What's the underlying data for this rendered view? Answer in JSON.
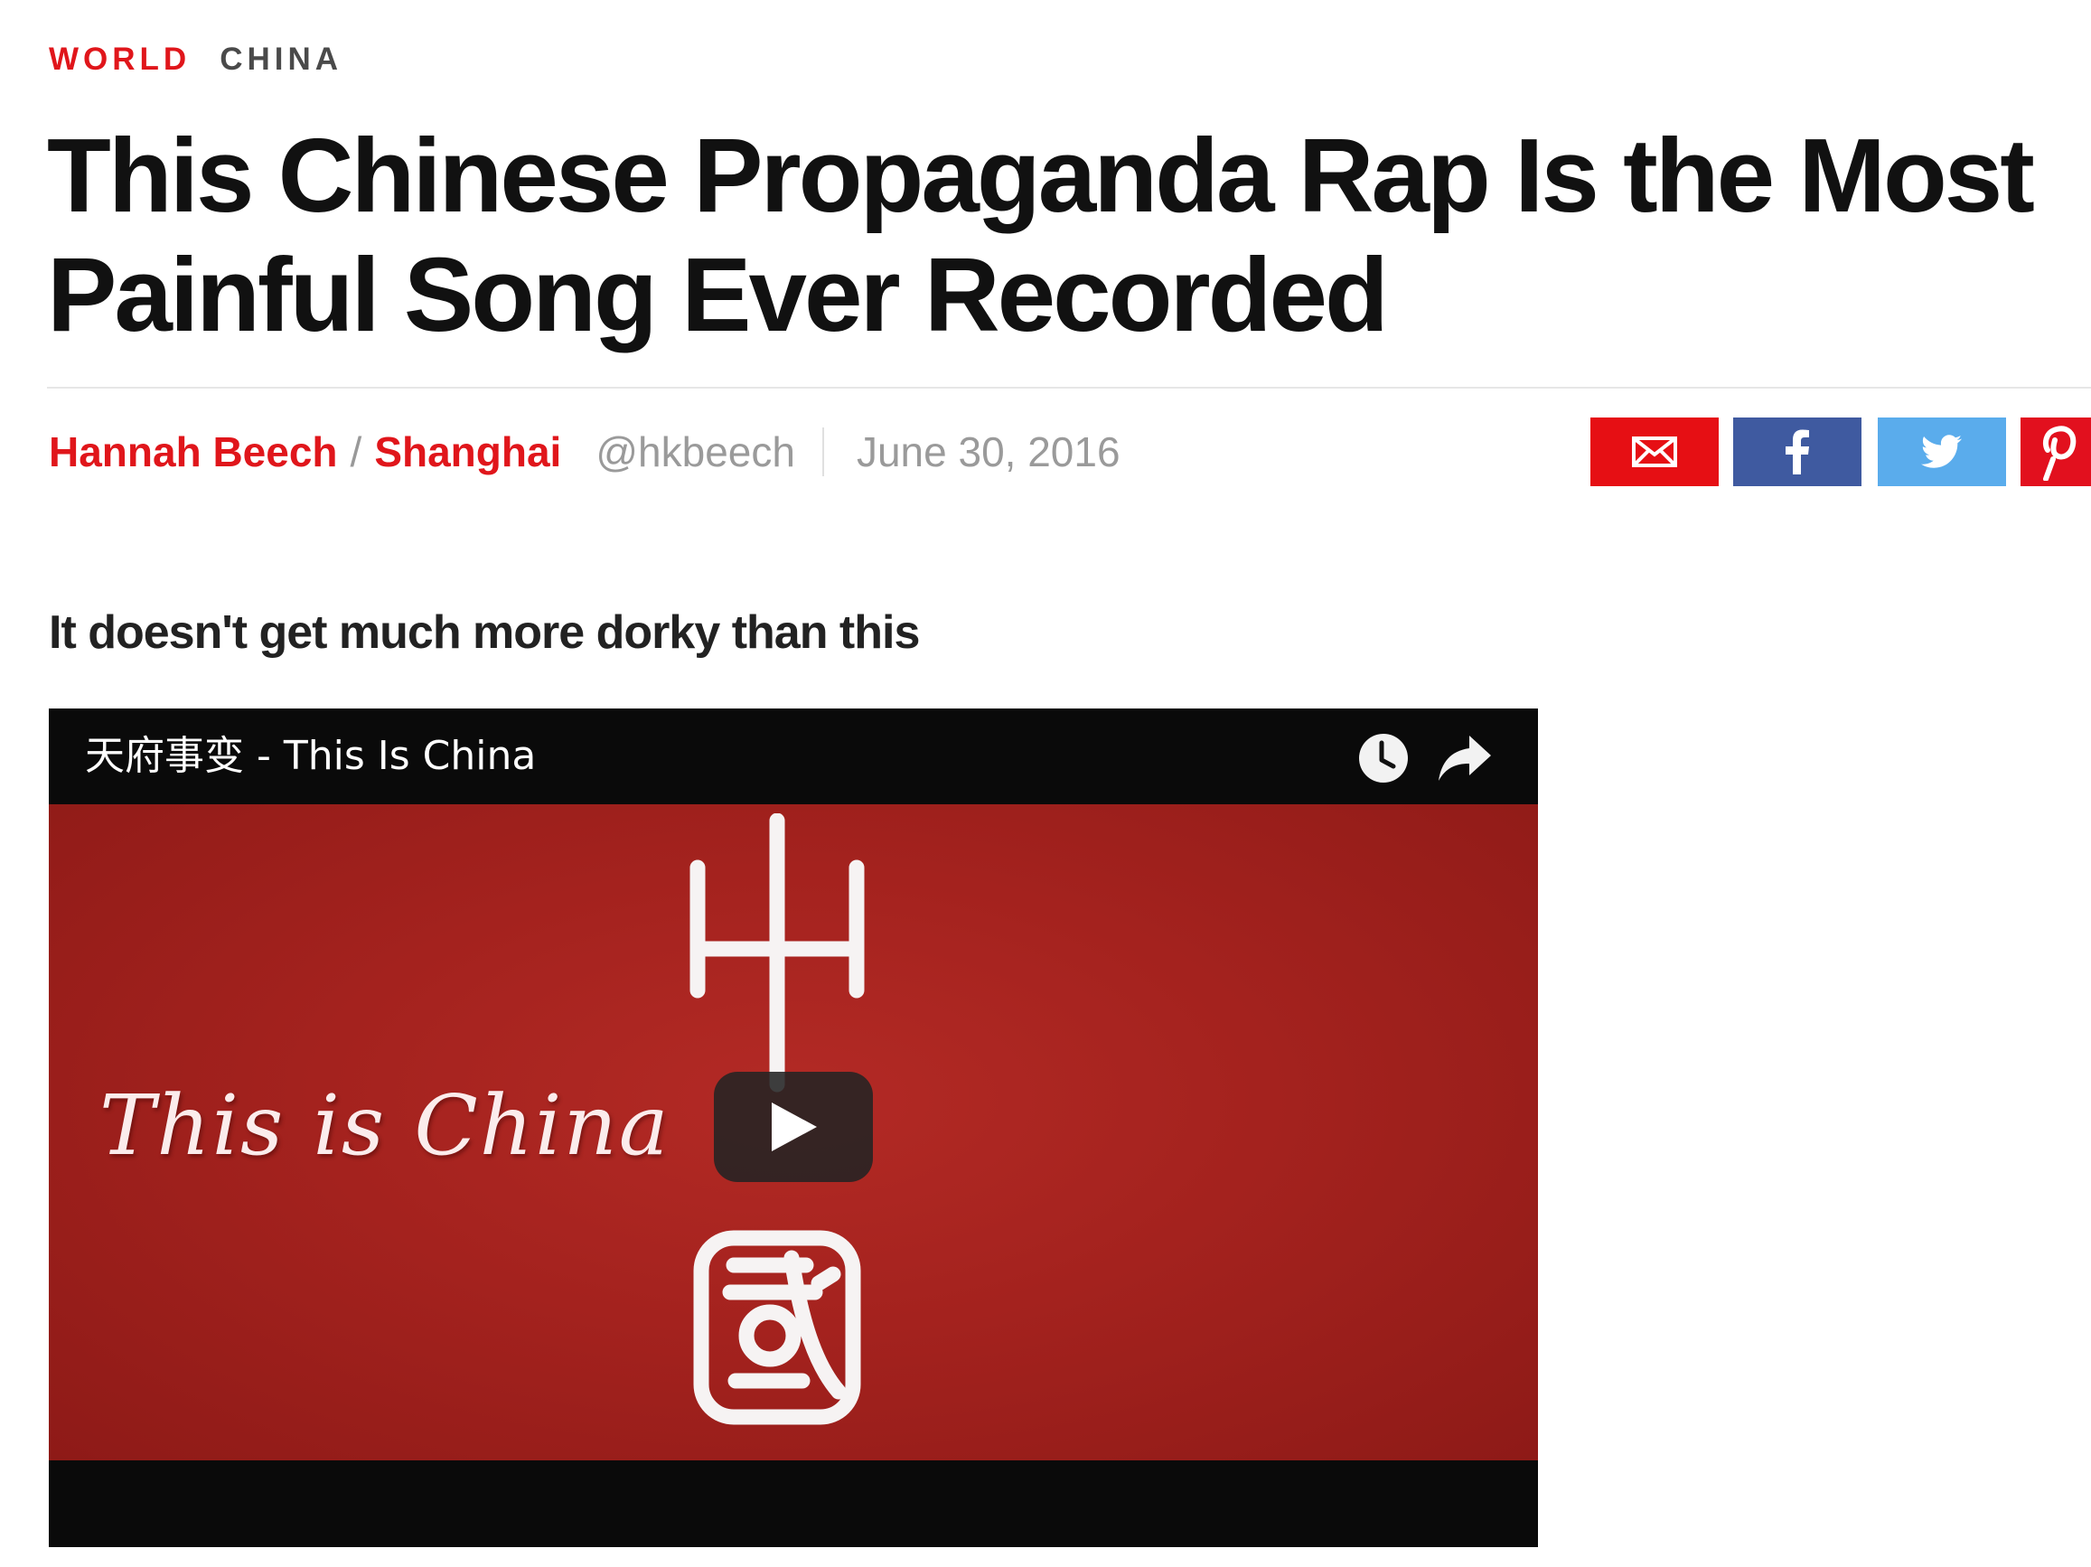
{
  "article": {
    "section": "WORLD",
    "subsection": "CHINA",
    "headline_line1": "This Chinese Propaganda Rap Is the Most",
    "headline_line2": "Painful Song Ever Recorded",
    "author": "Hannah Beech",
    "byline_separator": "/",
    "location": "Shanghai",
    "handle": "@hkbeech",
    "date": "June 30, 2016",
    "dek": "It doesn't get much more dorky than this"
  },
  "share": {
    "email_icon": "email-icon",
    "facebook_icon": "facebook-icon",
    "twitter_icon": "twitter-icon",
    "pinterest_icon": "pinterest-icon",
    "colors": {
      "email": "#e60f14",
      "facebook": "#3f5aa0",
      "twitter": "#5aacec",
      "pinterest": "#e2101e"
    }
  },
  "video": {
    "title": "天府事变 - This Is China",
    "thumbnail_text": "This is China",
    "thumbnail_seal_chars": "中國",
    "watch_later_icon": "clock-icon",
    "share_icon": "share-arrow-icon",
    "play_icon": "play-icon",
    "background_color": "#a4221e"
  },
  "colors": {
    "accent": "#e0161b",
    "muted": "#9a9a9a"
  }
}
